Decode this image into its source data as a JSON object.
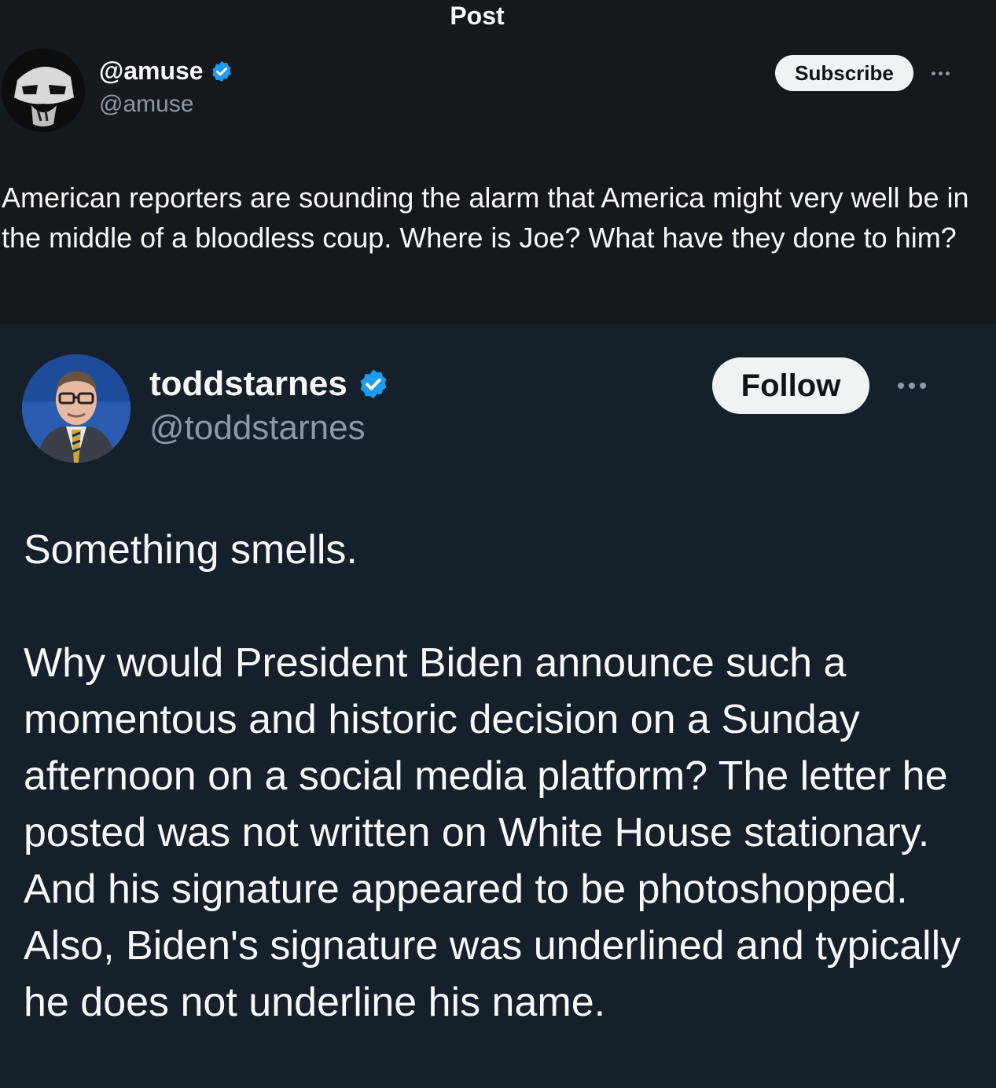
{
  "header": {
    "title": "Post"
  },
  "post": {
    "author_name": "@amuse",
    "author_handle": "@amuse",
    "subscribe_label": "Subscribe",
    "text": "American reporters are sounding the alarm that America might very well be in the middle of a bloodless coup. Where is Joe? What have they done to him?"
  },
  "quote": {
    "author_name": "toddstarnes",
    "author_handle": "@toddstarnes",
    "follow_label": "Follow",
    "paragraph1": "Something smells.",
    "paragraph2": "Why would President Biden announce such a momentous and historic decision on a Sunday afternoon on a social media platform? The letter he posted was not written on White House stationary. And his signature appeared to be photoshopped. Also, Biden's signature was underlined and typically he does not underline his name."
  },
  "icons": {
    "verified": "verified-badge-icon",
    "more": "more-options-icon"
  },
  "colors": {
    "background_top": "#15181c",
    "background_quote": "#15202b",
    "verified_blue": "#1d9bf0",
    "secondary_text": "#8b98a5"
  }
}
